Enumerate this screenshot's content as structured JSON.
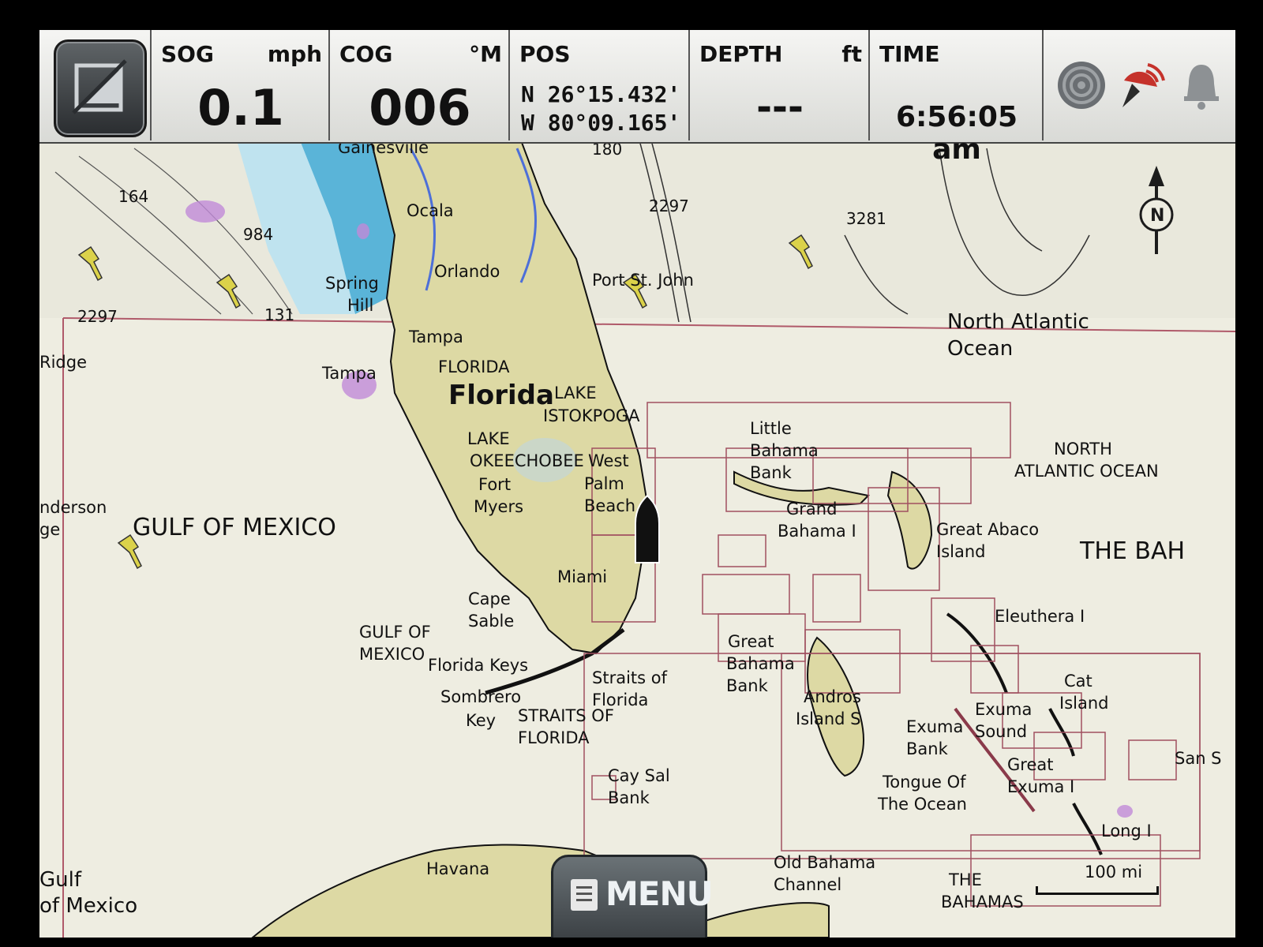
{
  "data_bar": {
    "sog": {
      "label": "SOG",
      "unit": "mph",
      "value": "0.1"
    },
    "cog": {
      "label": "COG",
      "unit": "°M",
      "value": "006"
    },
    "pos": {
      "label": "POS",
      "lat": "N 26°15.432'",
      "lon": "W 80°09.165'"
    },
    "depth": {
      "label": "DEPTH",
      "unit": "ft",
      "value": "---"
    },
    "time": {
      "label": "TIME",
      "value": "6:56:05 am"
    }
  },
  "status_icons": [
    "radar-icon",
    "satellite-dish-icon",
    "alarm-bell-icon"
  ],
  "menu": {
    "label": "MENU"
  },
  "scale": {
    "label": "100 mi"
  },
  "compass": {
    "label": "N"
  },
  "map_labels": {
    "gainesville": "Gainesville",
    "ocala": "Ocala",
    "orlando": "Orlando",
    "port_st_john": "Port St. John",
    "spring_hill_1": "Spring",
    "spring_hill_2": "Hill",
    "tampa": "Tampa",
    "tampa2": "Tampa",
    "florida_caps": "FLORIDA",
    "florida": "Florida",
    "lake_istokpoga_1": "LAKE",
    "lake_istokpoga_2": "ISTOKPOGA",
    "lake_okeechobee_1": "LAKE",
    "lake_okeechobee_2": "OKEECHOBEE",
    "west_palm_1": "West",
    "west_palm_2": "Palm",
    "west_palm_3": "Beach",
    "fort_myers_1": "Fort",
    "fort_myers_2": "Myers",
    "miami": "Miami",
    "cape_sable_1": "Cape",
    "cape_sable_2": "Sable",
    "gulf_of_mexico_big": "GULF OF MEXICO",
    "gulf_of_mexico_1": "GULF OF",
    "gulf_of_mexico_2": "MEXICO",
    "florida_keys": "Florida Keys",
    "sombrero_key_1": "Sombrero",
    "sombrero_key_2": "Key",
    "straits_1": "Straits of",
    "straits_2": "Florida",
    "straits_caps_1": "STRAITS OF",
    "straits_caps_2": "FLORIDA",
    "cay_sal_1": "Cay Sal",
    "cay_sal_2": "Bank",
    "havana": "Havana",
    "old_bahama_1": "Old Bahama",
    "old_bahama_2": "Channel",
    "the_bahamas_1": "THE",
    "the_bahamas_2": "BAHAMAS",
    "the_bah": "THE BAH",
    "north_atlantic_1": "North Atlantic",
    "north_atlantic_2": "Ocean",
    "north_atlantic_caps_1": "NORTH",
    "north_atlantic_caps_2": "ATLANTIC OCEAN",
    "little_bahama_1": "Little",
    "little_bahama_2": "Bahama",
    "little_bahama_3": "Bank",
    "grand_bahama_1": "Grand",
    "grand_bahama_2": "Bahama I",
    "great_abaco_1": "Great Abaco",
    "great_abaco_2": "Island",
    "eleuthera": "Eleuthera I",
    "great_bahama_bank_1": "Great",
    "great_bahama_bank_2": "Bahama",
    "great_bahama_bank_3": "Bank",
    "andros_1": "Andros",
    "andros_2": "Island S",
    "exuma_bank_1": "Exuma",
    "exuma_bank_2": "Bank",
    "exuma_sound_1": "Exuma",
    "exuma_sound_2": "Sound",
    "cat_island_1": "Cat",
    "cat_island_2": "Island",
    "great_exuma_1": "Great",
    "great_exuma_2": "Exuma I",
    "tongue_1": "Tongue Of",
    "tongue_2": "The Ocean",
    "san_s": "San S",
    "long_i": "Long I",
    "ridge": "Ridge",
    "anderson_1": "nderson",
    "anderson_2": "ge",
    "gulf_sw_1": "Gulf",
    "gulf_sw_2": "of Mexico",
    "depth_164": "164",
    "depth_984": "984",
    "depth_2297_w": "2297",
    "depth_131": "131",
    "depth_180": "180",
    "depth_2297_e": "2297",
    "depth_3281": "3281"
  }
}
